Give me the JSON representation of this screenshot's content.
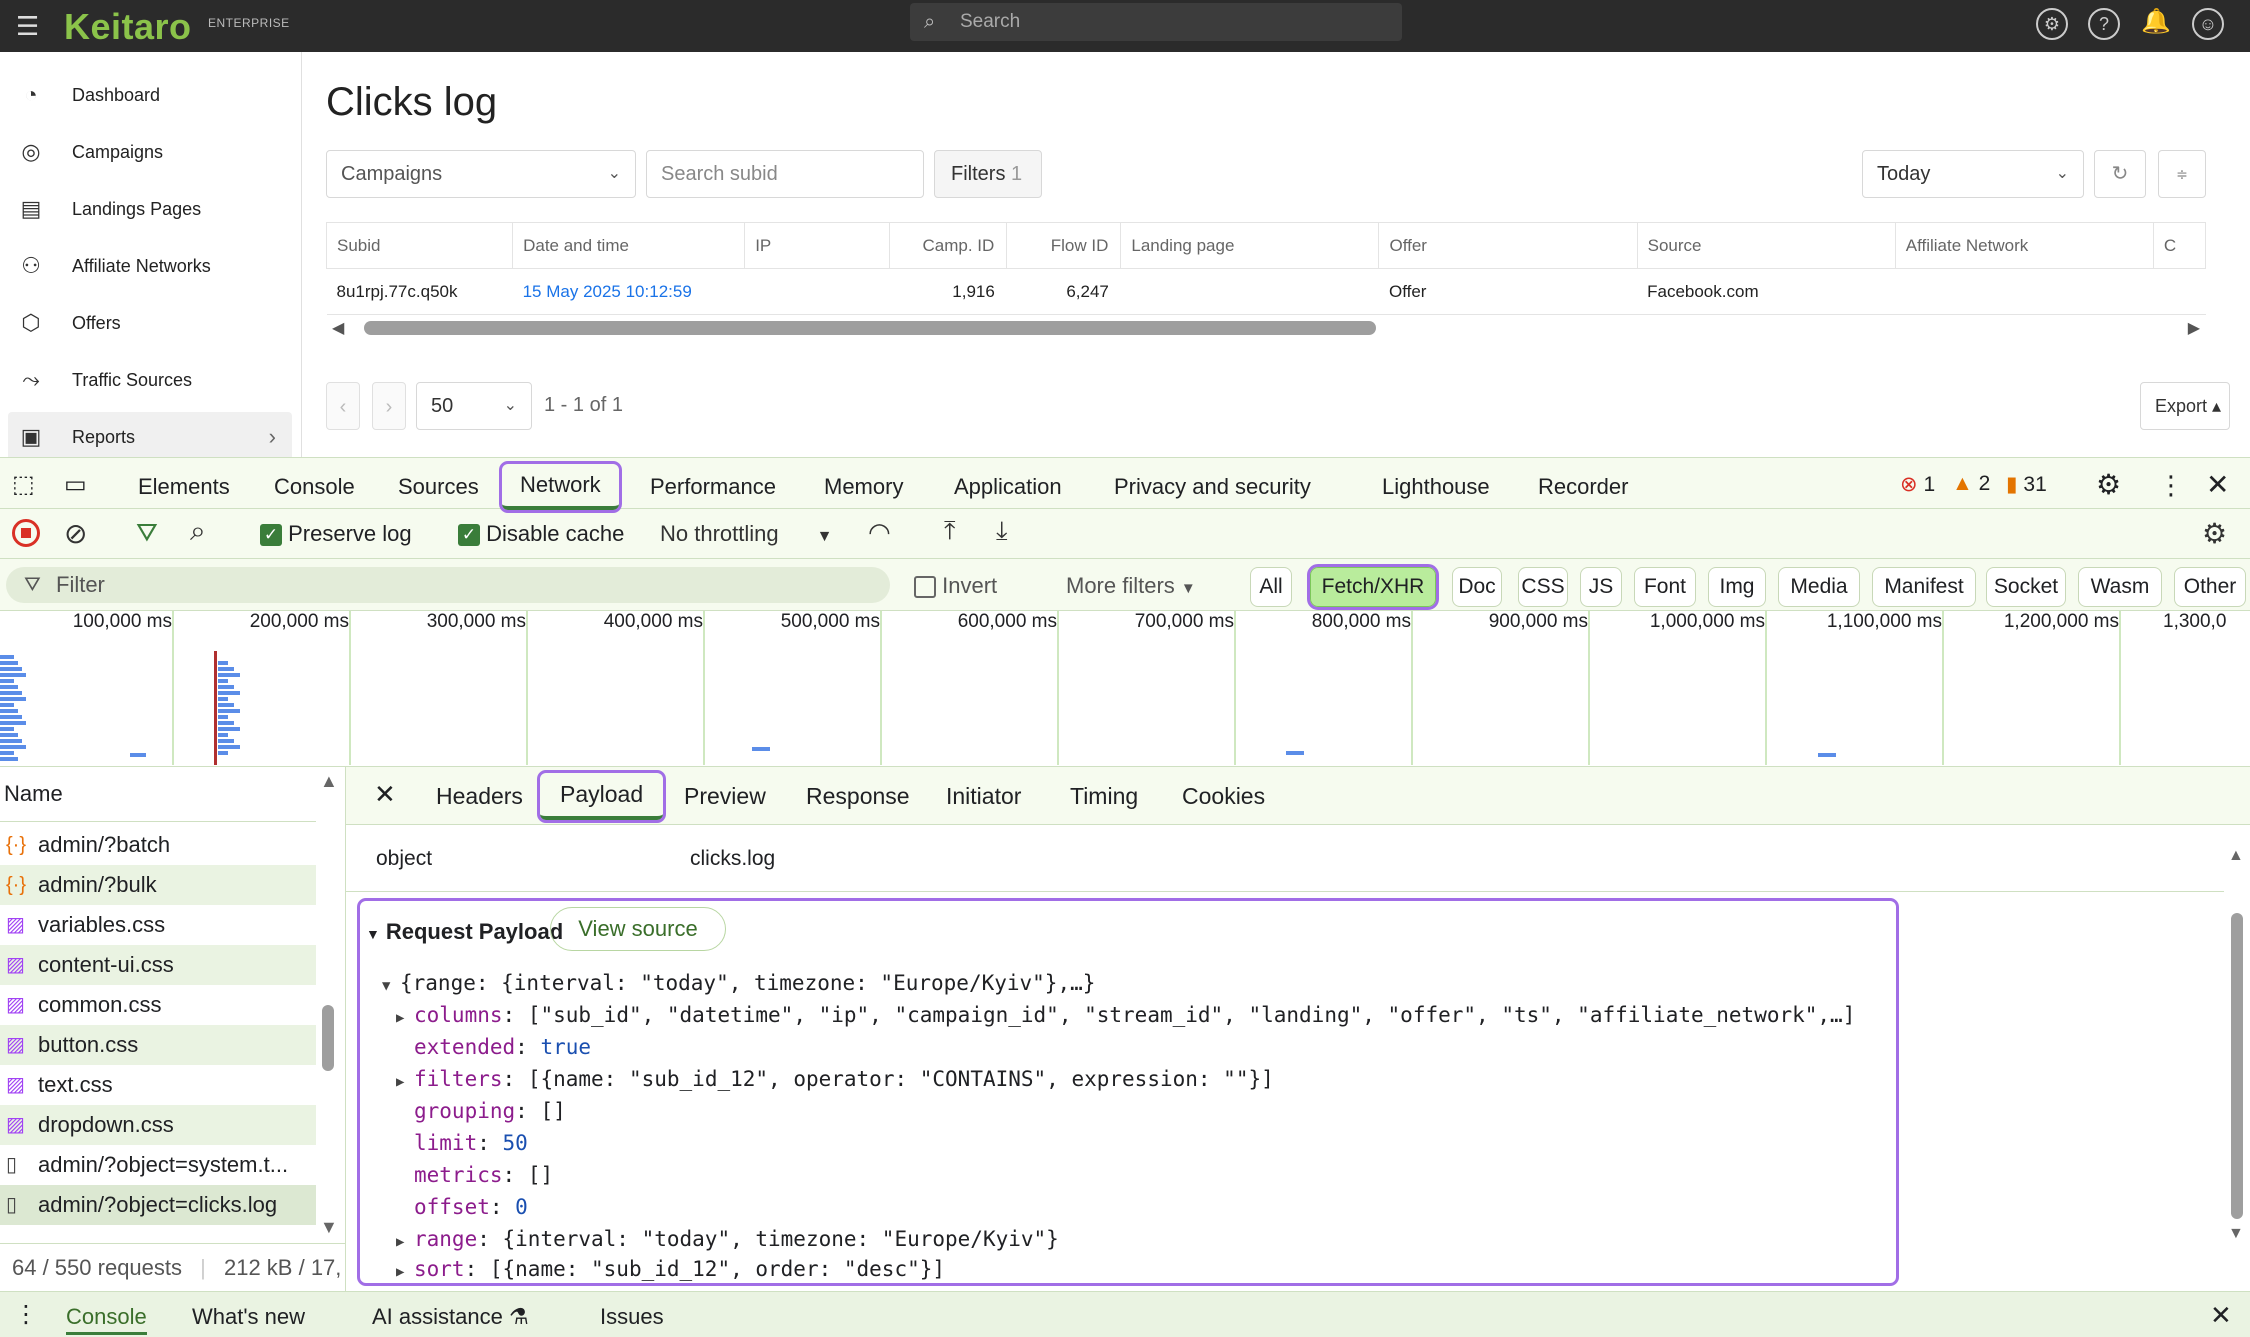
{
  "topbar": {
    "logo": "Keitaro",
    "logo_sub": "ENTERPRISE",
    "search_placeholder": "Search",
    "icons": [
      "settings-icon",
      "help-icon",
      "bell-icon",
      "account-icon"
    ]
  },
  "sidebar": {
    "items": [
      {
        "label": "Dashboard",
        "icon": "dashboard-icon"
      },
      {
        "label": "Campaigns",
        "icon": "campaigns-icon"
      },
      {
        "label": "Landings Pages",
        "icon": "landing-pages-icon"
      },
      {
        "label": "Affiliate Networks",
        "icon": "affiliate-networks-icon"
      },
      {
        "label": "Offers",
        "icon": "offers-icon"
      },
      {
        "label": "Traffic Sources",
        "icon": "traffic-sources-icon"
      },
      {
        "label": "Reports",
        "icon": "reports-icon"
      }
    ]
  },
  "main": {
    "title": "Clicks log",
    "campaigns_select": "Campaigns",
    "search_subid_placeholder": "Search subid",
    "filters_label": "Filters",
    "filters_count": "1",
    "date_select": "Today",
    "columns": [
      "Subid",
      "Date and time",
      "IP",
      "Camp. ID",
      "Flow ID",
      "Landing page",
      "Offer",
      "Source",
      "Affiliate Network",
      "C"
    ],
    "rows": [
      {
        "subid": "8u1rpj.77c.q50k",
        "datetime": "15 May 2025 10:12:59",
        "ip": "",
        "camp_id": "1,916",
        "flow_id": "6,247",
        "landing": "",
        "offer": "Offer",
        "source": "Facebook.com",
        "affiliate": ""
      }
    ],
    "page_size": "50",
    "range_text": "1 - 1 of 1",
    "export_label": "Export"
  },
  "devtools": {
    "tabs": [
      "Elements",
      "Console",
      "Sources",
      "Network",
      "Performance",
      "Memory",
      "Application",
      "Privacy and security",
      "Lighthouse",
      "Recorder"
    ],
    "active_tab": "Network",
    "errors": "1",
    "warnings": "2",
    "issues": "31",
    "toolbar": {
      "preserve_log": "Preserve log",
      "disable_cache": "Disable cache",
      "throttling": "No throttling"
    },
    "filter_placeholder": "Filter",
    "invert_label": "Invert",
    "more_filters": "More filters",
    "type_filters": [
      "All",
      "Fetch/XHR",
      "Doc",
      "CSS",
      "JS",
      "Font",
      "Img",
      "Media",
      "Manifest",
      "Socket",
      "Wasm",
      "Other"
    ],
    "active_type": "Fetch/XHR",
    "timeline_ticks": [
      "100,000 ms",
      "200,000 ms",
      "300,000 ms",
      "400,000 ms",
      "500,000 ms",
      "600,000 ms",
      "700,000 ms",
      "800,000 ms",
      "900,000 ms",
      "1,000,000 ms",
      "1,100,000 ms",
      "1,200,000 ms",
      "1,300,0"
    ],
    "name_header": "Name",
    "requests": [
      {
        "name": "admin/?batch",
        "type": "xhr"
      },
      {
        "name": "admin/?bulk",
        "type": "xhr"
      },
      {
        "name": "variables.css",
        "type": "css"
      },
      {
        "name": "content-ui.css",
        "type": "css"
      },
      {
        "name": "common.css",
        "type": "css"
      },
      {
        "name": "button.css",
        "type": "css"
      },
      {
        "name": "text.css",
        "type": "css"
      },
      {
        "name": "dropdown.css",
        "type": "css"
      },
      {
        "name": "admin/?object=system.t...",
        "type": "doc"
      },
      {
        "name": "admin/?object=clicks.log",
        "type": "doc"
      }
    ],
    "summary_requests": "64 / 550 requests",
    "summary_size": "212 kB / 17,",
    "detail_tabs": [
      "Headers",
      "Payload",
      "Preview",
      "Response",
      "Initiator",
      "Timing",
      "Cookies"
    ],
    "active_detail_tab": "Payload",
    "query_param": {
      "key": "object",
      "value": "clicks.log"
    },
    "request_payload_title": "Request Payload",
    "view_source": "View source",
    "payload_lines": {
      "root": "{range: {interval: \"today\", timezone: \"Europe/Kyiv\"},…}",
      "columns_key": "columns",
      "columns_val": "[\"sub_id\", \"datetime\", \"ip\", \"campaign_id\", \"stream_id\", \"landing\", \"offer\", \"ts\", \"affiliate_network\",…]",
      "extended_key": "extended",
      "extended_val": "true",
      "filters_key": "filters",
      "filters_val": "[{name: \"sub_id_12\", operator: \"CONTAINS\", expression: \"\"}]",
      "grouping_key": "grouping",
      "grouping_val": "[]",
      "limit_key": "limit",
      "limit_val": "50",
      "metrics_key": "metrics",
      "metrics_val": "[]",
      "offset_key": "offset",
      "offset_val": "0",
      "range_key": "range",
      "range_val": "{interval: \"today\", timezone: \"Europe/Kyiv\"}",
      "sort_key": "sort",
      "sort_val": "[{name: \"sub_id_12\", order: \"desc\"}]"
    },
    "drawer_tabs": [
      "Console",
      "What's new",
      "AI assistance",
      "Issues"
    ]
  }
}
